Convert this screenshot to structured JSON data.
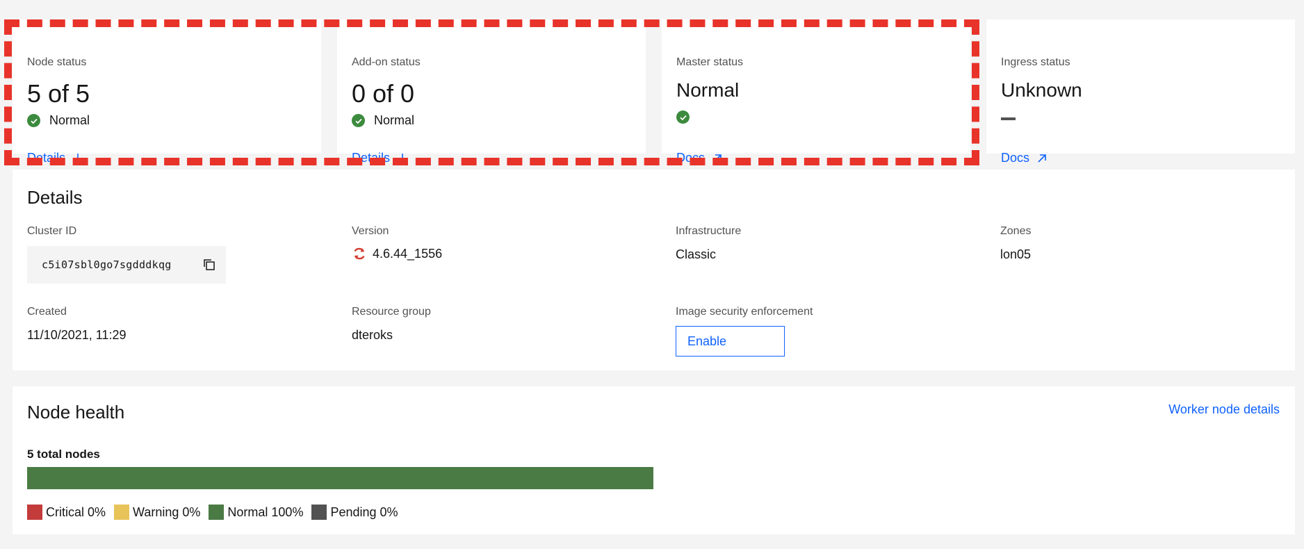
{
  "status_tiles": [
    {
      "label": "Node status",
      "value": "5 of 5",
      "sub": "Normal",
      "link": "Details"
    },
    {
      "label": "Add-on status",
      "value": "0 of 0",
      "sub": "Normal",
      "link": "Details"
    },
    {
      "label": "Master status",
      "value": "Normal",
      "link": "Docs"
    },
    {
      "label": "Ingress status",
      "value": "Unknown",
      "link": "Docs"
    }
  ],
  "details": {
    "title": "Details",
    "cluster_id_label": "Cluster ID",
    "cluster_id": "c5i07sbl0go7sgdddkqg",
    "version_label": "Version",
    "version": "4.6.44_1556",
    "infrastructure_label": "Infrastructure",
    "infrastructure": "Classic",
    "zones_label": "Zones",
    "zones": "lon05",
    "created_label": "Created",
    "created": "11/10/2021, 11:29",
    "resource_group_label": "Resource group",
    "resource_group": "dteroks",
    "image_security_label": "Image security enforcement",
    "enable_button": "Enable"
  },
  "node_health": {
    "title": "Node health",
    "worker_link": "Worker node details",
    "total_label": "5 total nodes",
    "segments": [
      {
        "name": "Critical",
        "label": "Critical 0%",
        "percent": 0,
        "color": "#c43b3b"
      },
      {
        "name": "Warning",
        "label": "Warning 0%",
        "percent": 0,
        "color": "#e8c35a"
      },
      {
        "name": "Normal",
        "label": "Normal 100%",
        "percent": 100,
        "color": "#4b7b44"
      },
      {
        "name": "Pending",
        "label": "Pending 0%",
        "percent": 0,
        "color": "#525252"
      }
    ]
  },
  "colors": {
    "link": "#0f62fe",
    "success": "#3c8a3e",
    "highlight": "#e8332a"
  }
}
